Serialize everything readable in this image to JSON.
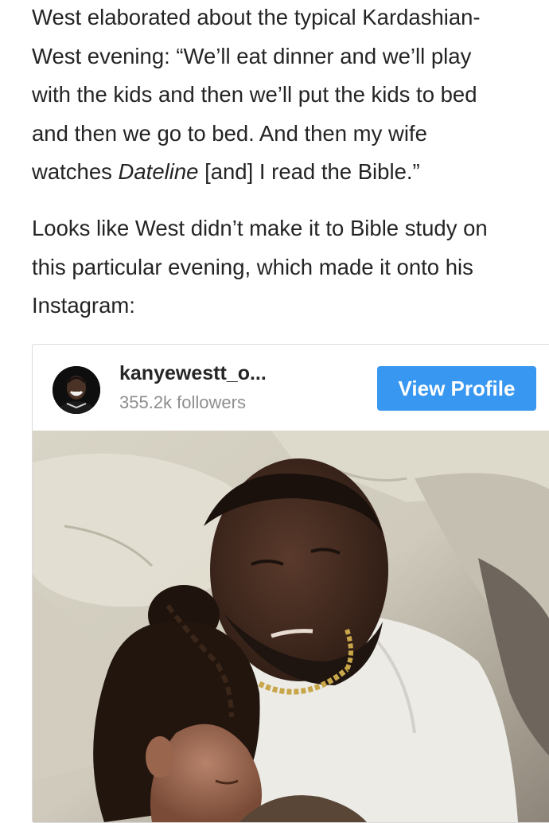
{
  "article": {
    "para1_lines": [
      "West elaborated about the typical Kardashian-",
      "West evening: “We’ll eat dinner and we’ll play",
      "with the kids and then we’ll put the kids to bed",
      "and then we go to bed. And then my wife"
    ],
    "para1_last_prefix": "watches ",
    "para1_last_italic": "Dateline",
    "para1_last_suffix": " [and] I read the Bible.”",
    "para2_lines": [
      "Looks like West didn’t make it to Bible study on",
      "this particular evening, which made it onto his",
      "Instagram:"
    ]
  },
  "instagram_embed": {
    "username": "kanyewestt_o...",
    "followers": "355.2k followers",
    "view_profile_label": "View Profile",
    "button_color": "#3897f0",
    "avatar_icon": "profile-photo",
    "photo_icon": "post-photo"
  }
}
